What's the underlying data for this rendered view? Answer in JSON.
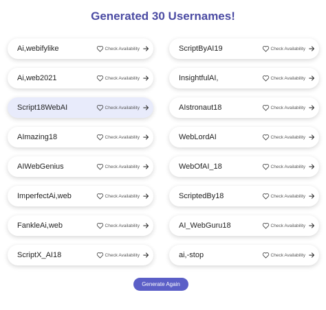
{
  "title": "Generated 30 Usernames!",
  "check_label": "Check Availability",
  "usernames": [
    "Ai,webifylike",
    "ScriptByAI19",
    "Ai,web2021",
    "InsightfulAI,",
    "Script18WebAI",
    "AIstronaut18",
    "AImazing18",
    "WebLordAI",
    "AIWebGenius",
    "WebOfAI_18",
    "ImperfectAi,web",
    "ScriptedBy18",
    "FankleAi,web",
    "AI_WebGuru18",
    "ScriptX_AI18",
    "ai,-stop"
  ],
  "highlighted_index": 4,
  "generate_label": "Generate Again",
  "colors": {
    "title": "#4b4ba3",
    "button": "#5b5fc7",
    "highlight": "#e8ebfb"
  },
  "icons": {
    "favorite": "heart-icon",
    "go": "arrow-right-icon"
  }
}
